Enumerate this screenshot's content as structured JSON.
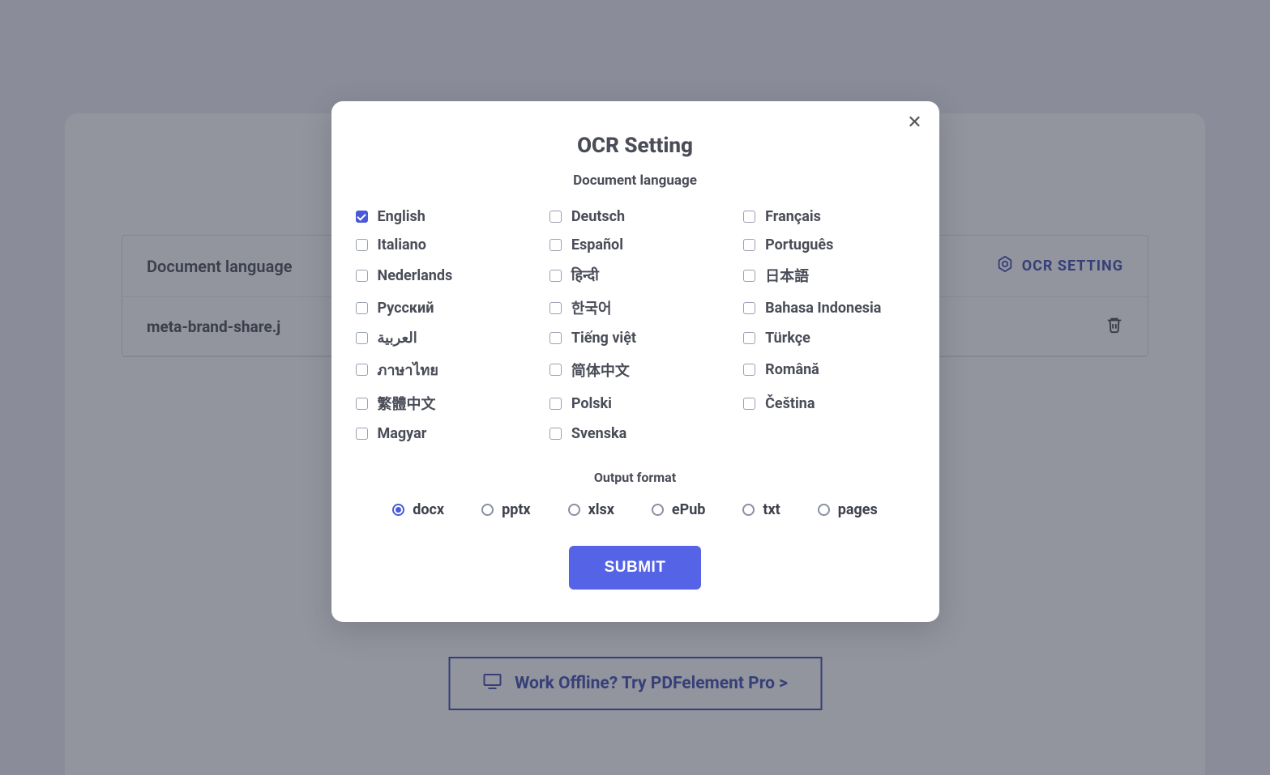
{
  "background": {
    "panel": {
      "doc_language_label": "Document language",
      "ocr_setting_label": "OCR SETTING",
      "filename": "meta-brand-share.j"
    },
    "offline_button": "Work Offline? Try PDFelement Pro >"
  },
  "modal": {
    "title": "OCR Setting",
    "subtitle": "Document language",
    "languages": [
      {
        "label": "English",
        "checked": true
      },
      {
        "label": "Deutsch",
        "checked": false
      },
      {
        "label": "Français",
        "checked": false
      },
      {
        "label": "Italiano",
        "checked": false
      },
      {
        "label": "Español",
        "checked": false
      },
      {
        "label": "Português",
        "checked": false
      },
      {
        "label": "Nederlands",
        "checked": false
      },
      {
        "label": "हिन्दी",
        "checked": false
      },
      {
        "label": "日本語",
        "checked": false
      },
      {
        "label": "Русский",
        "checked": false
      },
      {
        "label": "한국어",
        "checked": false
      },
      {
        "label": "Bahasa Indonesia",
        "checked": false
      },
      {
        "label": "العربية",
        "checked": false
      },
      {
        "label": "Tiếng việt",
        "checked": false
      },
      {
        "label": "Türkçe",
        "checked": false
      },
      {
        "label": "ภาษาไทย",
        "checked": false
      },
      {
        "label": "简体中文",
        "checked": false
      },
      {
        "label": "Română",
        "checked": false
      },
      {
        "label": "繁體中文",
        "checked": false
      },
      {
        "label": "Polski",
        "checked": false
      },
      {
        "label": "Čeština",
        "checked": false
      },
      {
        "label": "Magyar",
        "checked": false
      },
      {
        "label": "Svenska",
        "checked": false
      }
    ],
    "output_title": "Output format",
    "formats": [
      {
        "label": "docx",
        "selected": true
      },
      {
        "label": "pptx",
        "selected": false
      },
      {
        "label": "xlsx",
        "selected": false
      },
      {
        "label": "ePub",
        "selected": false
      },
      {
        "label": "txt",
        "selected": false
      },
      {
        "label": "pages",
        "selected": false
      }
    ],
    "submit_label": "SUBMIT"
  }
}
